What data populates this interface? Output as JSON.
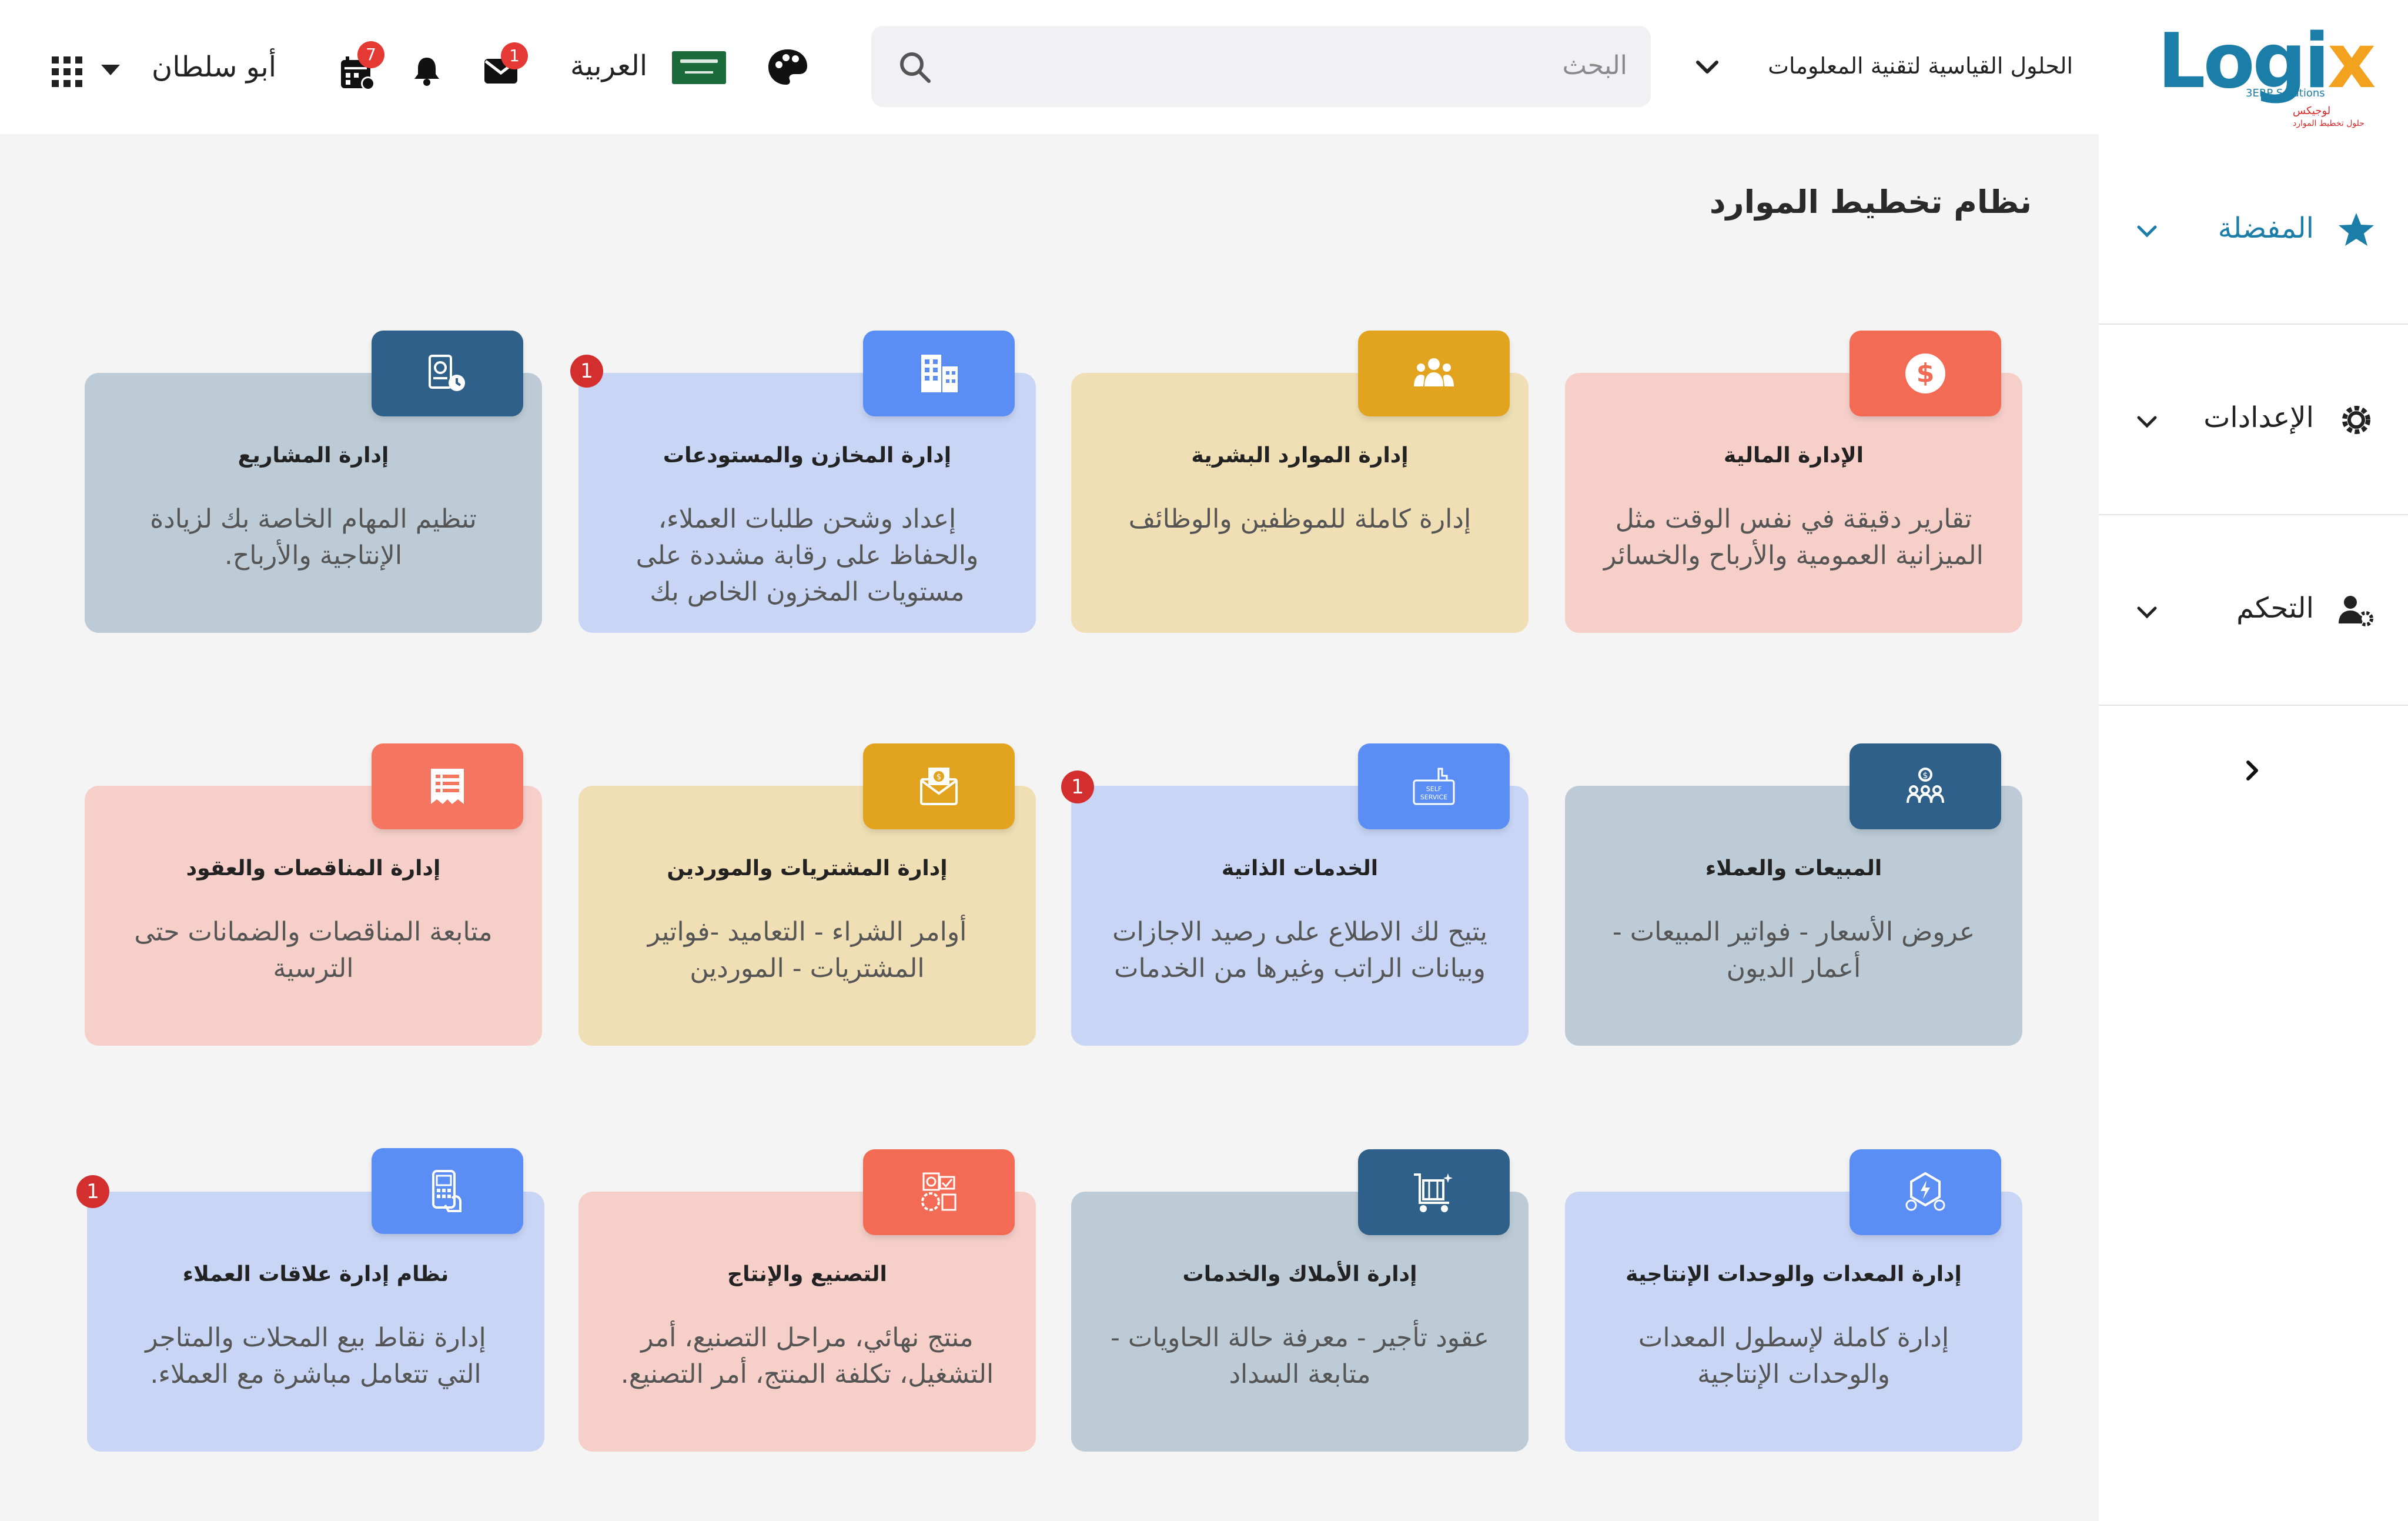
{
  "header": {
    "logo_text": "Logix",
    "logo_subtitle": "3ERP Solutions",
    "logo_arabic": "لوجيكس",
    "logo_arabic_sub": "حلول تخطيط الموارد",
    "company": "الحلول القياسية لتقنية المعلومات",
    "search_placeholder": "البحث",
    "language": "العربية",
    "username": "أبو سلطان",
    "badges": {
      "mail": "1",
      "calendar": "7"
    }
  },
  "sidebar": {
    "items": [
      {
        "label": "المفضلة",
        "icon": "star-icon",
        "color": "#1b7ea8"
      },
      {
        "label": "الإعدادات",
        "icon": "gear-icon",
        "color": "#222222"
      },
      {
        "label": "التحكم",
        "icon": "users-gear-icon",
        "color": "#222222"
      }
    ]
  },
  "page": {
    "title": "نظام تخطيط الموارد"
  },
  "cards": [
    {
      "title": "الإدارة المالية",
      "desc": "تقارير دقيقة في نفس الوقت مثل الميزانية العمومية والأرباح والخسائر",
      "icon": "dollar-icon",
      "badge": ""
    },
    {
      "title": "إدارة الموارد البشرية",
      "desc": "إدارة كاملة للموظفين والوظائف",
      "icon": "people-icon",
      "badge": ""
    },
    {
      "title": "إدارة المخازن والمستودعات",
      "desc": "إعداد وشحن طلبات العملاء، والحفاظ على رقابة مشددة على مستويات المخزون الخاص بك",
      "icon": "buildings-icon",
      "badge": "1"
    },
    {
      "title": "إدارة المشاريع",
      "desc": "تنظيم المهام الخاصة بك لزيادة الإنتاجية والأرباح.",
      "icon": "project-money-icon",
      "badge": ""
    },
    {
      "title": "المبيعات والعملاء",
      "desc": "عروض الأسعار - فواتير المبيعات - أعمار الديون",
      "icon": "customers-icon",
      "badge": ""
    },
    {
      "title": "الخدمات الذاتية",
      "desc": "يتيح لك الاطلاع على رصيد الاجازات وبيانات الراتب وغيرها من الخدمات",
      "icon": "self-service-icon",
      "badge": "1"
    },
    {
      "title": "إدارة المشتريات والموردين",
      "desc": "أوامر الشراء - التعاميد -فواتير المشتريات - الموردين",
      "icon": "purchase-envelope-icon",
      "badge": ""
    },
    {
      "title": "إدارة المناقصات والعقود",
      "desc": "متابعة المناقصات والضمانات حتى الترسية",
      "icon": "contract-icon",
      "badge": ""
    },
    {
      "title": "إدارة المعدات والوحدات الإنتاجية",
      "desc": "إدارة كاملة لإسطول المعدات والوحدات الإنتاجية",
      "icon": "equipment-icon",
      "badge": ""
    },
    {
      "title": "إدارة الأملاك والخدمات",
      "desc": "عقود تأجير - معرفة حالة الحاويات - متابعة السداد",
      "icon": "property-cart-icon",
      "badge": ""
    },
    {
      "title": "التصنيع والإنتاج",
      "desc": "منتج نهائي، مراحل التصنيع، أمر التشغيل، تكلفة المنتج، أمر التصنيع.",
      "icon": "manufacturing-icon",
      "badge": ""
    },
    {
      "title": "نظام إدارة علاقات العملاء",
      "desc": "إدارة نقاط بيع المحلات والمتاجر التي تتعامل مباشرة مع العملاء.",
      "icon": "pos-hand-icon",
      "badge": "1"
    }
  ]
}
